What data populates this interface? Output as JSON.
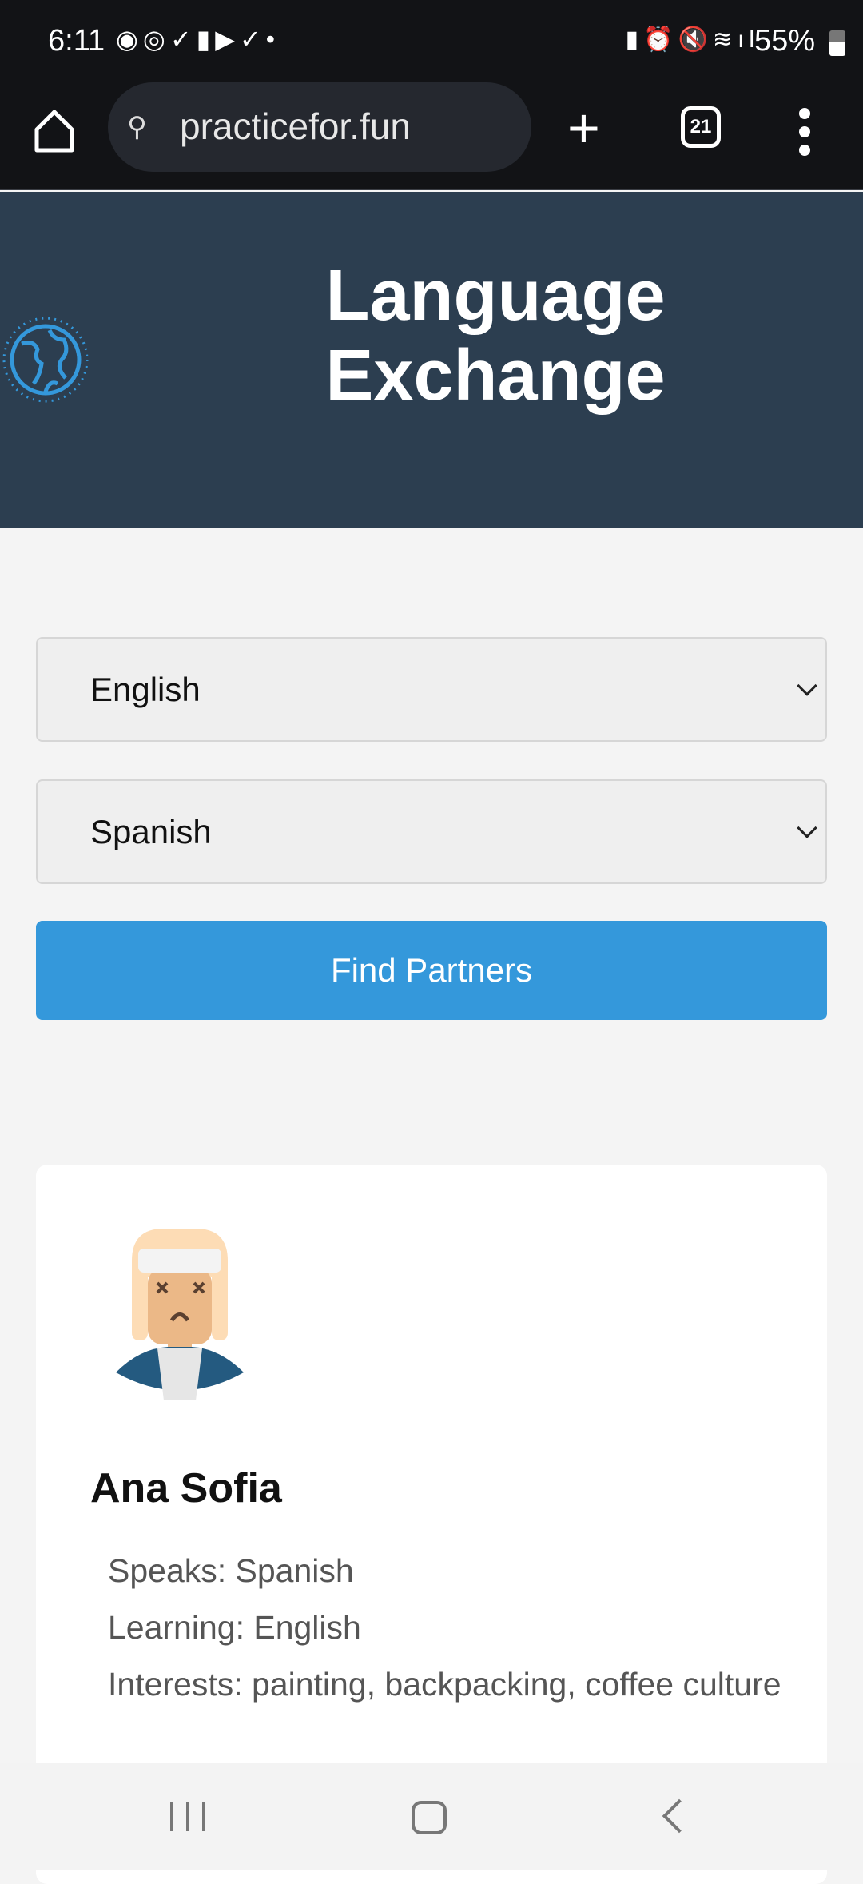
{
  "status_bar": {
    "time": "6:11",
    "battery": "55%",
    "notification_icons": [
      "discord-icon",
      "chrome-icon",
      "tasks-icon",
      "app-icon",
      "youtube-icon",
      "vivaldi-icon",
      "dot-icon"
    ],
    "system_icons": [
      "battery-saver-icon",
      "alarm-icon",
      "mute-icon",
      "wifi-icon",
      "signal-icon"
    ]
  },
  "browser": {
    "url": "practicefor.fun",
    "tab_count": "21"
  },
  "header": {
    "title_line1": "Language",
    "title_line2": "Exchange"
  },
  "form": {
    "native_language": "English",
    "target_language": "Spanish",
    "find_button": "Find Partners"
  },
  "partners": [
    {
      "name": "Ana Sofia",
      "speaks": "Speaks: Spanish",
      "learning": "Learning: English",
      "interests": "Interests: painting, backpacking, coffee culture"
    }
  ],
  "colors": {
    "header_bg": "#2c3e50",
    "accent": "#3498db"
  }
}
